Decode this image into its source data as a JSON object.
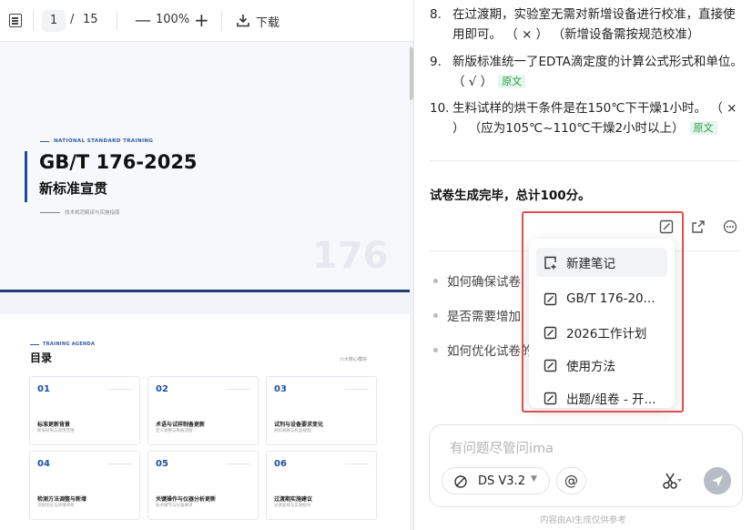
{
  "pdf_toolbar": {
    "current_page": "1",
    "slash": "/",
    "total_pages": "15",
    "zoom_out": "—",
    "zoom": "100%",
    "zoom_in": "+",
    "download_label": "下载"
  },
  "slide1": {
    "eyebrow": "NATIONAL STANDARD TRAINING",
    "title": "GB/T 176-2025",
    "subtitle": "新标准宣贯",
    "caption": "技术规范解读与实施指南",
    "watermark": "176"
  },
  "slide2": {
    "eyebrow": "TRAINING AGENDA",
    "title": "目录",
    "right_note": "六大核心模块",
    "cards": [
      {
        "num": "01",
        "title": "标准更新背景",
        "sub": "新旧对照与适用范围"
      },
      {
        "num": "02",
        "title": "术语与试样制备更新",
        "sub": "定义调整与制备流程"
      },
      {
        "num": "03",
        "title": "试剂与设备要求变化",
        "sub": "材料规格与校准规程"
      },
      {
        "num": "04",
        "title": "检测方法调整与新增",
        "sub": "流程优化与新增项目"
      },
      {
        "num": "05",
        "title": "关键操作与仪器分析更新",
        "sub": "技术细节与仪器要求"
      },
      {
        "num": "06",
        "title": "过渡期实施建议",
        "sub": "过渡安排与实践指导"
      }
    ]
  },
  "answer": {
    "items": [
      {
        "num": "8.",
        "text": "在过渡期，实验室无需对新增设备进行校准，直接使用即可。 （ × ） （新增设备需按规范校准）",
        "badge": ""
      },
      {
        "num": "9.",
        "text": "新版标准统一了EDTA滴定度的计算公式形式和单位。 （ √ ）",
        "badge": "原文"
      },
      {
        "num": "10.",
        "text": "生料试样的烘干条件是在150℃下干燥1小时。 （ × ） （应为105℃~110℃干燥2小时以上）",
        "badge": "原文"
      }
    ],
    "summary": "试卷生成完毕，总计100分。"
  },
  "suggestions": [
    "如何确保试卷",
    "是否需要增加",
    "如何优化试卷的"
  ],
  "note_menu": {
    "items": [
      {
        "label": "新建笔记",
        "icon": "new-note-icon"
      },
      {
        "label": "GB/T 176-20...",
        "icon": "edit-note-icon"
      },
      {
        "label": "2026工作计划",
        "icon": "edit-note-icon"
      },
      {
        "label": "使用方法",
        "icon": "edit-note-icon"
      },
      {
        "label": "出题/组卷 - 开...",
        "icon": "edit-note-icon"
      }
    ]
  },
  "composer": {
    "placeholder": "有问题尽管问ima",
    "model": "DS V3.2",
    "at_label": "@",
    "footnote": "内容由AI生成仅供参考"
  },
  "colors": {
    "accent_blue": "#1e4fa0",
    "highlight_red": "#e44c4c",
    "badge_green": "#2a9a4e"
  }
}
